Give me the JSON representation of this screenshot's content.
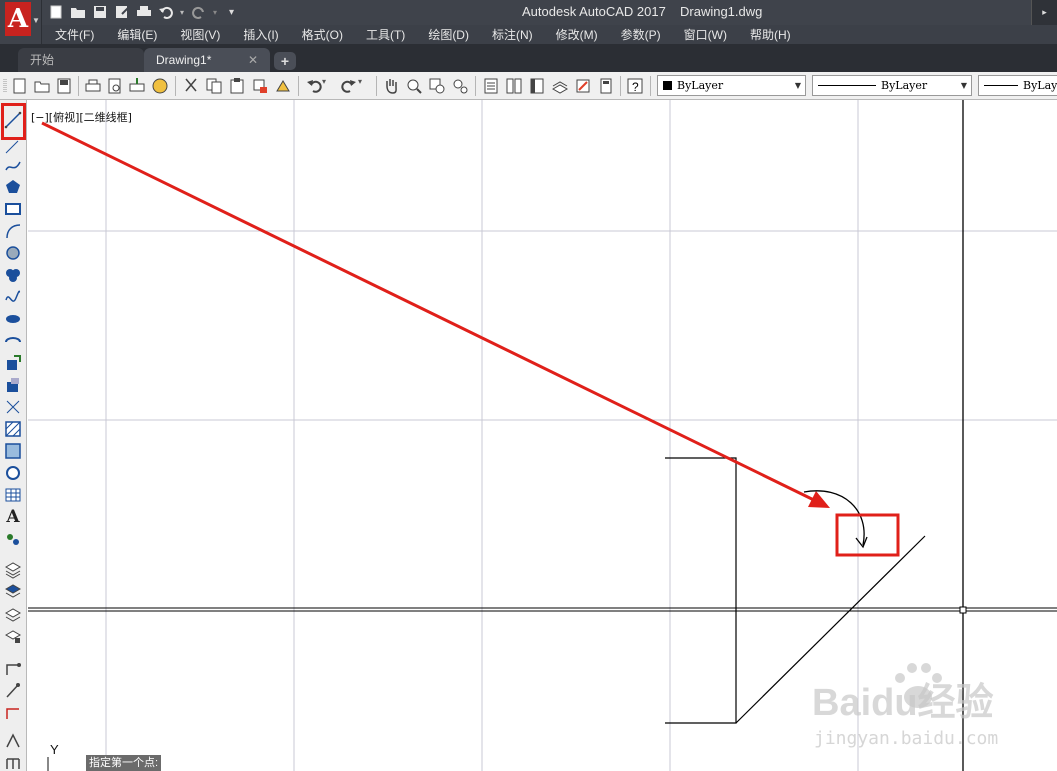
{
  "titlebar": {
    "app_title": "Autodesk AutoCAD 2017",
    "file_name": "Drawing1.dwg"
  },
  "menubar": {
    "items": [
      "文件(F)",
      "编辑(E)",
      "视图(V)",
      "插入(I)",
      "格式(O)",
      "工具(T)",
      "绘图(D)",
      "标注(N)",
      "修改(M)",
      "参数(P)",
      "窗口(W)",
      "帮助(H)"
    ]
  },
  "tabs": {
    "start": "开始",
    "drawing": "Drawing1*",
    "close": "✕",
    "add": "+"
  },
  "toolbar": {
    "color_value": "ByLayer",
    "linetype_value": "ByLayer",
    "lineweight_value": "ByLayer"
  },
  "canvas": {
    "viewport_label": "[−][俯视][二维线框]",
    "command_prompt": "指定第一个点:",
    "ucs_y_label": "Y"
  },
  "watermark": {
    "brand": "Baidu经验",
    "url": "jingyan.baidu.com"
  },
  "colors": {
    "highlight_red": "#e0201a",
    "titlebar": "#3f434b",
    "app_logo": "#c8231f",
    "grid": "#c9c9d4"
  }
}
